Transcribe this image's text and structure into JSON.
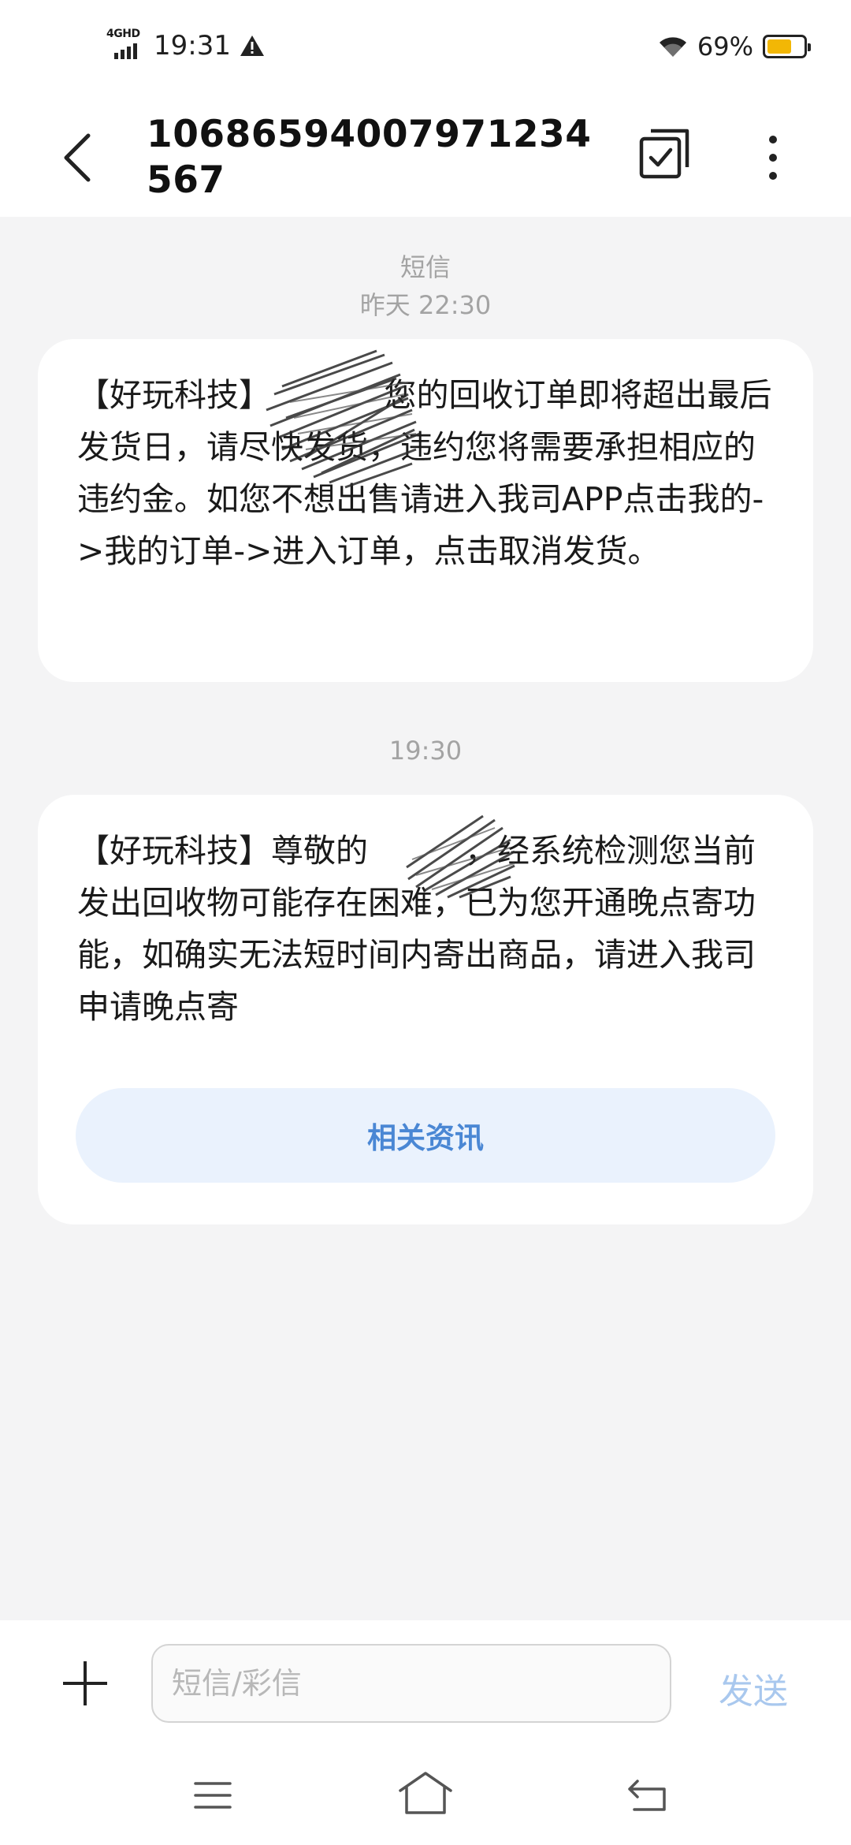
{
  "status_bar": {
    "network": "4GHD",
    "time": "19:31",
    "battery_percent_text": "69%",
    "battery_level": 0.69,
    "battery_color": "#f2b705"
  },
  "header": {
    "contact_number": "10686594007971234567",
    "back_icon": "chevron-left-icon",
    "select_icon": "multi-select-checkbox-icon",
    "more_icon": "vertical-dots-icon"
  },
  "thread": {
    "messages": [
      {
        "channel_label": "短信",
        "timestamp": "昨天  22:30",
        "text": "【好玩科技】　　　　您的回收订单即将超出最后发货日，请尽快发货，违约您将需要承担相应的违约金。如您不想出售请进入我司APP点击我的->我的订单->进入订单，点击取消发货。"
      },
      {
        "timestamp": "19:30",
        "text": "【好玩科技】尊敬的　　　，经系统检测您当前发出回收物可能存在困难，已为您开通晚点寄功能，如确实无法短时间内寄出商品，请进入我司申请晚点寄",
        "action_label": "相关资讯"
      }
    ]
  },
  "compose": {
    "placeholder": "短信/彩信",
    "send_label": "发送",
    "accent_color": "#a9c8ee"
  },
  "nav_bar": {
    "icons": [
      "menu-icon",
      "home-icon",
      "back-icon"
    ]
  }
}
